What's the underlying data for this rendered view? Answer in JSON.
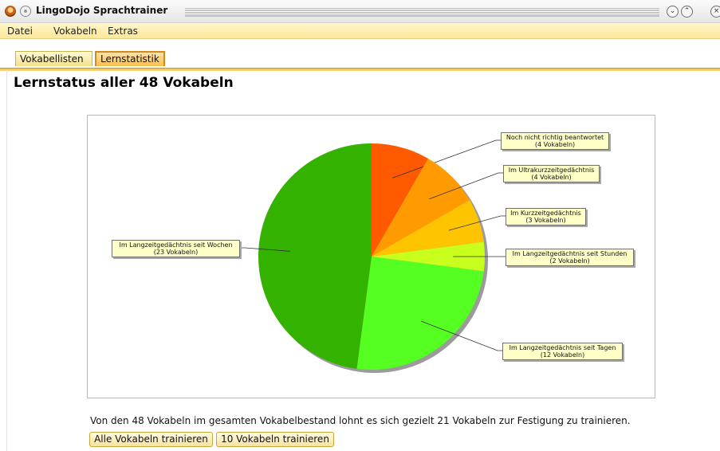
{
  "window": {
    "title": "LingoDojo Sprachtrainer"
  },
  "menu": {
    "items": [
      "Datei",
      "Vokabeln",
      "Extras"
    ]
  },
  "tabs": [
    {
      "label": "Vokabellisten",
      "active": false
    },
    {
      "label": "Lernstatistik",
      "active": true
    }
  ],
  "page": {
    "title": "Lernstatus aller 48 Vokabeln"
  },
  "chart_data": {
    "type": "pie",
    "start_angle": "12 o'clock",
    "direction": "clockwise",
    "slices": [
      {
        "label": "Noch nicht richtig beantwortet",
        "count_label": "(4 Vokabeln)",
        "value": 4,
        "color": "#ff5a00"
      },
      {
        "label": "Im Ultrakurzzeitgedächtnis",
        "count_label": "(4 Vokabeln)",
        "value": 4,
        "color": "#ff9a00"
      },
      {
        "label": "Im Kurzzeitgedächtnis",
        "count_label": "(3 Vokabeln)",
        "value": 3,
        "color": "#ffc400"
      },
      {
        "label": "Im Langzeitgedächtnis seit Stunden",
        "count_label": "(2 Vokabeln)",
        "value": 2,
        "color": "#c9ff1c"
      },
      {
        "label": "Im Langzeitgedächtnis seit Tagen",
        "count_label": "(12 Vokabeln)",
        "value": 12,
        "color": "#55ff22"
      },
      {
        "label": "Im Langzeitgedächtnis seit Wochen",
        "count_label": "(23 Vokabeln)",
        "value": 23,
        "color": "#33b200"
      }
    ]
  },
  "summary": "Von den 48 Vokabeln im gesamten Vokabelbestand lohnt es sich gezielt 21 Vokabeln zur Festigung zu trainieren.",
  "buttons": {
    "train_all": "Alle Vokabeln trainieren",
    "train_ten": "10 Vokabeln trainieren"
  }
}
